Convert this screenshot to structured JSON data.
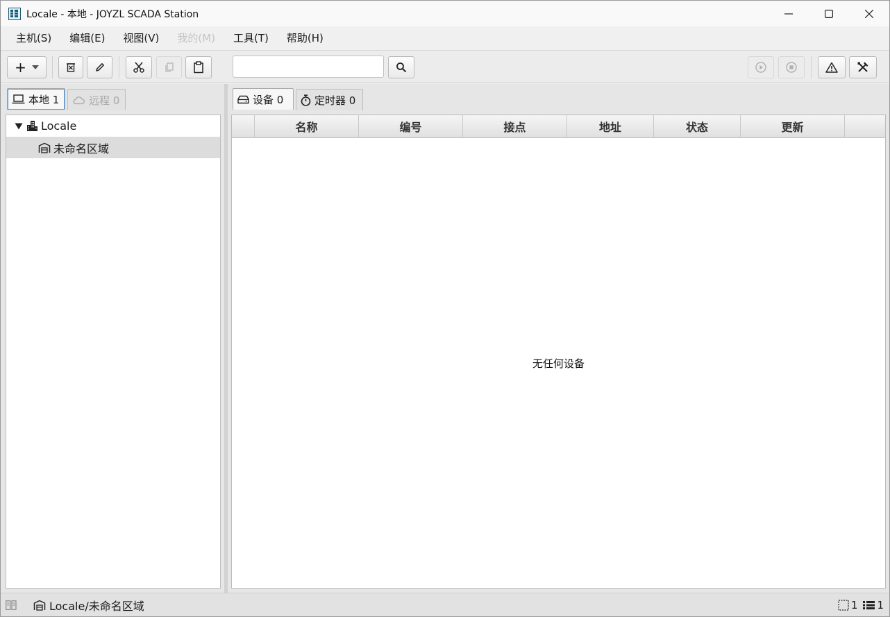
{
  "window": {
    "title": "Locale - 本地 - JOYZL SCADA Station",
    "icon": "app-grid-icon"
  },
  "menu": {
    "items": [
      {
        "label": "主机(S)",
        "enabled": true
      },
      {
        "label": "编辑(E)",
        "enabled": true
      },
      {
        "label": "视图(V)",
        "enabled": true
      },
      {
        "label": "我的(M)",
        "enabled": false
      },
      {
        "label": "工具(T)",
        "enabled": true
      },
      {
        "label": "帮助(H)",
        "enabled": true
      }
    ]
  },
  "toolbar": {
    "add_label": "+",
    "search_value": "",
    "search_placeholder": ""
  },
  "left_tabs": [
    {
      "label": "本地 1",
      "icon": "laptop-icon",
      "active": true
    },
    {
      "label": "远程 0",
      "icon": "cloud-icon",
      "active": false
    }
  ],
  "tree": {
    "root": {
      "label": "Locale",
      "icon": "buildings-icon",
      "expanded": true
    },
    "children": [
      {
        "label": "未命名区域",
        "icon": "warehouse-icon",
        "selected": true
      }
    ]
  },
  "right_tabs": [
    {
      "label": "设备 0",
      "icon": "drive-icon",
      "active": true
    },
    {
      "label": "定时器 0",
      "icon": "stopwatch-icon",
      "active": false
    }
  ],
  "table": {
    "columns": [
      "",
      "名称",
      "编号",
      "接点",
      "地址",
      "状态",
      "更新",
      ""
    ],
    "rows": [],
    "empty_message": "无任何设备"
  },
  "status": {
    "path": "Locale/未命名区域",
    "selection_count": "1",
    "list_count": "1"
  }
}
